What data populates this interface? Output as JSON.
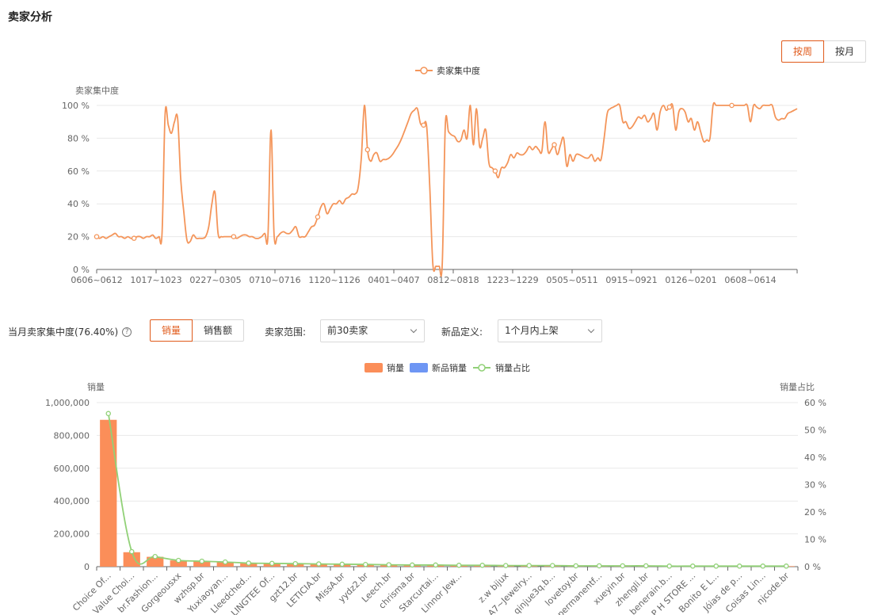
{
  "page": {
    "title": "卖家分析"
  },
  "period_toggle": {
    "week": "按周",
    "month": "按月",
    "active": "week"
  },
  "concentration": {
    "label": "当月卖家集中度(76.40%)",
    "help_icon": "question-circle-icon"
  },
  "metric_toggle": {
    "volume": "销量",
    "amount": "销售额",
    "active": "volume"
  },
  "filters": {
    "seller_range_label": "卖家范围:",
    "seller_range_value": "前30卖家",
    "new_def_label": "新品定义:",
    "new_def_value": "1个月内上架"
  },
  "chart_data": [
    {
      "type": "line",
      "legend": [
        "卖家集中度"
      ],
      "ylabel": "卖家集中度",
      "ylim": [
        0,
        100
      ],
      "yticks": [
        "0 %",
        "20 %",
        "40 %",
        "60 %",
        "80 %",
        "100 %"
      ],
      "xtick_labels": [
        "0606~0612",
        "1017~1023",
        "0227~0305",
        "0710~0716",
        "1120~1126",
        "0401~0407",
        "0812~0818",
        "1223~1229",
        "0505~0511",
        "0915~0921",
        "0126~0201",
        "0608~0614"
      ],
      "color": "#f4955a",
      "series": [
        {
          "name": "卖家集中度",
          "values": [
            20,
            19,
            20,
            19,
            20,
            21,
            22,
            20,
            20,
            19,
            20,
            19,
            19,
            20,
            20,
            19,
            20,
            20,
            21,
            19,
            20,
            22,
            95,
            88,
            83,
            90,
            92,
            55,
            35,
            18,
            17,
            21,
            19,
            19,
            19,
            20,
            26,
            40,
            47,
            22,
            20,
            20,
            20,
            20,
            20,
            19,
            20,
            21,
            21,
            20,
            20,
            19,
            19,
            20,
            22,
            20,
            85,
            21,
            20,
            22,
            23,
            22,
            22,
            24,
            26,
            20,
            20,
            20,
            23,
            26,
            27,
            32,
            38,
            40,
            34,
            37,
            40,
            40,
            42,
            40,
            43,
            44,
            46,
            46,
            50,
            68,
            100,
            73,
            66,
            70,
            71,
            66,
            67,
            67,
            68,
            70,
            73,
            76,
            80,
            85,
            90,
            95,
            97,
            98,
            89,
            88,
            87,
            50,
            3,
            2,
            2,
            3,
            88,
            84,
            82,
            81,
            78,
            79,
            85,
            80,
            100,
            76,
            98,
            75,
            80,
            85,
            65,
            62,
            60,
            56,
            62,
            62,
            65,
            70,
            68,
            71,
            70,
            70,
            72,
            75,
            73,
            75,
            73,
            72,
            90,
            72,
            73,
            76,
            70,
            76,
            80,
            63,
            70,
            66,
            70,
            70,
            69,
            68,
            68,
            70,
            66,
            68,
            67,
            80,
            95,
            98,
            99,
            100,
            100,
            90,
            90,
            86,
            87,
            90,
            93,
            92,
            94,
            90,
            92,
            95,
            85,
            96,
            100,
            97,
            99,
            100,
            85,
            96,
            98,
            96,
            90,
            92,
            85,
            90,
            84,
            78,
            79,
            80,
            100,
            100,
            100,
            100,
            100,
            100,
            100,
            100,
            100,
            100,
            100,
            100,
            90,
            100,
            99,
            98,
            100,
            100,
            100,
            100,
            93,
            91,
            92,
            92,
            95,
            96,
            97,
            98
          ]
        }
      ]
    },
    {
      "type": "bar",
      "legend": [
        "销量",
        "新品销量",
        "销量占比"
      ],
      "ylabel": "销量",
      "y2label": "销量占比",
      "ylim": [
        0,
        1000000
      ],
      "y2lim": [
        0,
        60
      ],
      "yticks": [
        "0",
        "200,000",
        "400,000",
        "600,000",
        "800,000",
        "1,000,000"
      ],
      "y2ticks": [
        "0 %",
        "10 %",
        "20 %",
        "30 %",
        "40 %",
        "50 %",
        "60 %"
      ],
      "categories": [
        "Choice Of...",
        "Value Choi...",
        "br.Fashion...",
        "Gorgeousxx",
        "wzhsp.br",
        "Yuxiaoyan...",
        "Lleedched...",
        "LINGTEE Of...",
        "gzt12.br",
        "LETICIA.br",
        "MissA.br",
        "yydz2.br",
        "Leech.br",
        "chrisma.br",
        "Starcurtai...",
        "Linnor Jew...",
        "",
        "z.w bijux",
        "A7~Jewelry...",
        "qinjue3q.b...",
        "lovetoy.br",
        "permanentf...",
        "xueyin.br",
        "zhengli.br",
        "benerain.b...",
        "P H STORE ...",
        "Bonito E L...",
        "Jóias de p...",
        "Coisas Lin...",
        "njcode.br"
      ],
      "colors": {
        "volume": "#fb8e59",
        "new_volume": "#6e96f4",
        "share": "#91d177"
      },
      "series": [
        {
          "name": "销量",
          "values": [
            895000,
            88000,
            60000,
            38000,
            33000,
            28000,
            22000,
            20000,
            19000,
            17000,
            16000,
            14000,
            12000,
            11000,
            10000,
            9000,
            8000,
            7500,
            7000,
            6500,
            6000,
            5500,
            5000,
            4800,
            4500,
            4200,
            4000,
            3800,
            3500,
            3200
          ]
        },
        {
          "name": "新品销量",
          "values": [
            0,
            0,
            0,
            0,
            0,
            0,
            0,
            0,
            0,
            0,
            0,
            0,
            0,
            0,
            0,
            0,
            0,
            0,
            0,
            0,
            0,
            0,
            0,
            0,
            0,
            0,
            0,
            0,
            0,
            0
          ]
        },
        {
          "name": "销量占比",
          "values": [
            56,
            5.5,
            3.7,
            2.3,
            2.0,
            1.7,
            1.3,
            1.2,
            1.1,
            1.0,
            0.9,
            0.8,
            0.7,
            0.6,
            0.6,
            0.5,
            0.5,
            0.4,
            0.4,
            0.4,
            0.3,
            0.3,
            0.3,
            0.3,
            0.2,
            0.2,
            0.2,
            0.2,
            0.2,
            0.2
          ]
        }
      ]
    }
  ]
}
